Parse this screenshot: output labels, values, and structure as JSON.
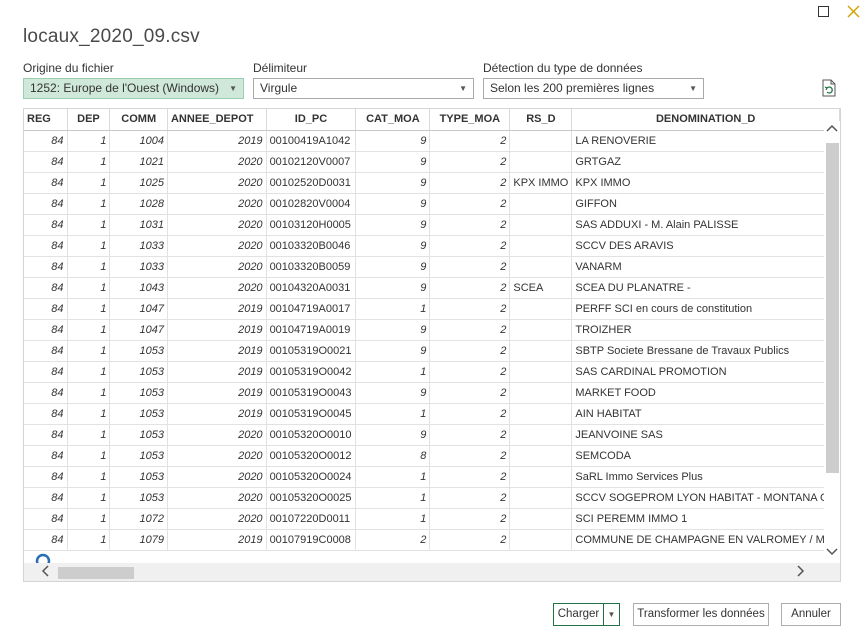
{
  "title": "locaux_2020_09.csv",
  "origin": {
    "label": "Origine du fichier",
    "value": "1252: Europe de l'Ouest (Windows)"
  },
  "delimiter": {
    "label": "Délimiteur",
    "value": "Virgule"
  },
  "detection": {
    "label": "Détection du type de données",
    "value": "Selon les 200 premières lignes"
  },
  "table": {
    "columns": [
      "REG",
      "DEP",
      "COMM",
      "ANNEE_DEPOT",
      "ID_PC",
      "CAT_MOA",
      "TYPE_MOA",
      "RS_D",
      "DENOMINATION_D"
    ],
    "rows": [
      [
        "84",
        "1",
        "1004",
        "2019",
        "00100419A1042",
        "9",
        "2",
        "",
        "LA RENOVERIE"
      ],
      [
        "84",
        "1",
        "1021",
        "2020",
        "00102120V0007",
        "9",
        "2",
        "",
        "GRTGAZ"
      ],
      [
        "84",
        "1",
        "1025",
        "2020",
        "00102520D0031",
        "9",
        "2",
        "KPX IMMO",
        "KPX IMMO"
      ],
      [
        "84",
        "1",
        "1028",
        "2020",
        "00102820V0004",
        "9",
        "2",
        "",
        "GIFFON"
      ],
      [
        "84",
        "1",
        "1031",
        "2020",
        "00103120H0005",
        "9",
        "2",
        "",
        "SAS ADDUXI - M. Alain PALISSE"
      ],
      [
        "84",
        "1",
        "1033",
        "2020",
        "00103320B0046",
        "9",
        "2",
        "",
        "SCCV DES ARAVIS"
      ],
      [
        "84",
        "1",
        "1033",
        "2020",
        "00103320B0059",
        "9",
        "2",
        "",
        "VANARM"
      ],
      [
        "84",
        "1",
        "1043",
        "2020",
        "00104320A0031",
        "9",
        "2",
        "SCEA",
        "SCEA DU PLANATRE -"
      ],
      [
        "84",
        "1",
        "1047",
        "2019",
        "00104719A0017",
        "1",
        "2",
        "",
        "PERFF SCI en cours de constitution"
      ],
      [
        "84",
        "1",
        "1047",
        "2019",
        "00104719A0019",
        "9",
        "2",
        "",
        "TROIZHER"
      ],
      [
        "84",
        "1",
        "1053",
        "2019",
        "00105319O0021",
        "9",
        "2",
        "",
        "SBTP Societe Bressane de Travaux Publics"
      ],
      [
        "84",
        "1",
        "1053",
        "2019",
        "00105319O0042",
        "1",
        "2",
        "",
        "SAS CARDINAL PROMOTION"
      ],
      [
        "84",
        "1",
        "1053",
        "2019",
        "00105319O0043",
        "9",
        "2",
        "",
        "MARKET FOOD"
      ],
      [
        "84",
        "1",
        "1053",
        "2019",
        "00105319O0045",
        "1",
        "2",
        "",
        "AIN HABITAT"
      ],
      [
        "84",
        "1",
        "1053",
        "2020",
        "00105320O0010",
        "9",
        "2",
        "",
        "JEANVOINE SAS"
      ],
      [
        "84",
        "1",
        "1053",
        "2020",
        "00105320O0012",
        "8",
        "2",
        "",
        "SEMCODA"
      ],
      [
        "84",
        "1",
        "1053",
        "2020",
        "00105320O0024",
        "1",
        "2",
        "",
        "SaRL Immo Services Plus"
      ],
      [
        "84",
        "1",
        "1053",
        "2020",
        "00105320O0025",
        "1",
        "2",
        "",
        "SCCV SOGEPROM LYON HABITAT - MONTANA GE"
      ],
      [
        "84",
        "1",
        "1072",
        "2020",
        "00107220D0011",
        "1",
        "2",
        "",
        "SCI PEREMM IMMO 1"
      ],
      [
        "84",
        "1",
        "1079",
        "2019",
        "00107919C0008",
        "2",
        "2",
        "",
        "COMMUNE DE CHAMPAGNE EN VALROMEY / M"
      ]
    ]
  },
  "buttons": {
    "load": "Charger",
    "transform": "Transformer les données",
    "cancel": "Annuler"
  },
  "colors": {
    "accent": "#217346",
    "origin_bg": "#cfe8d9"
  }
}
